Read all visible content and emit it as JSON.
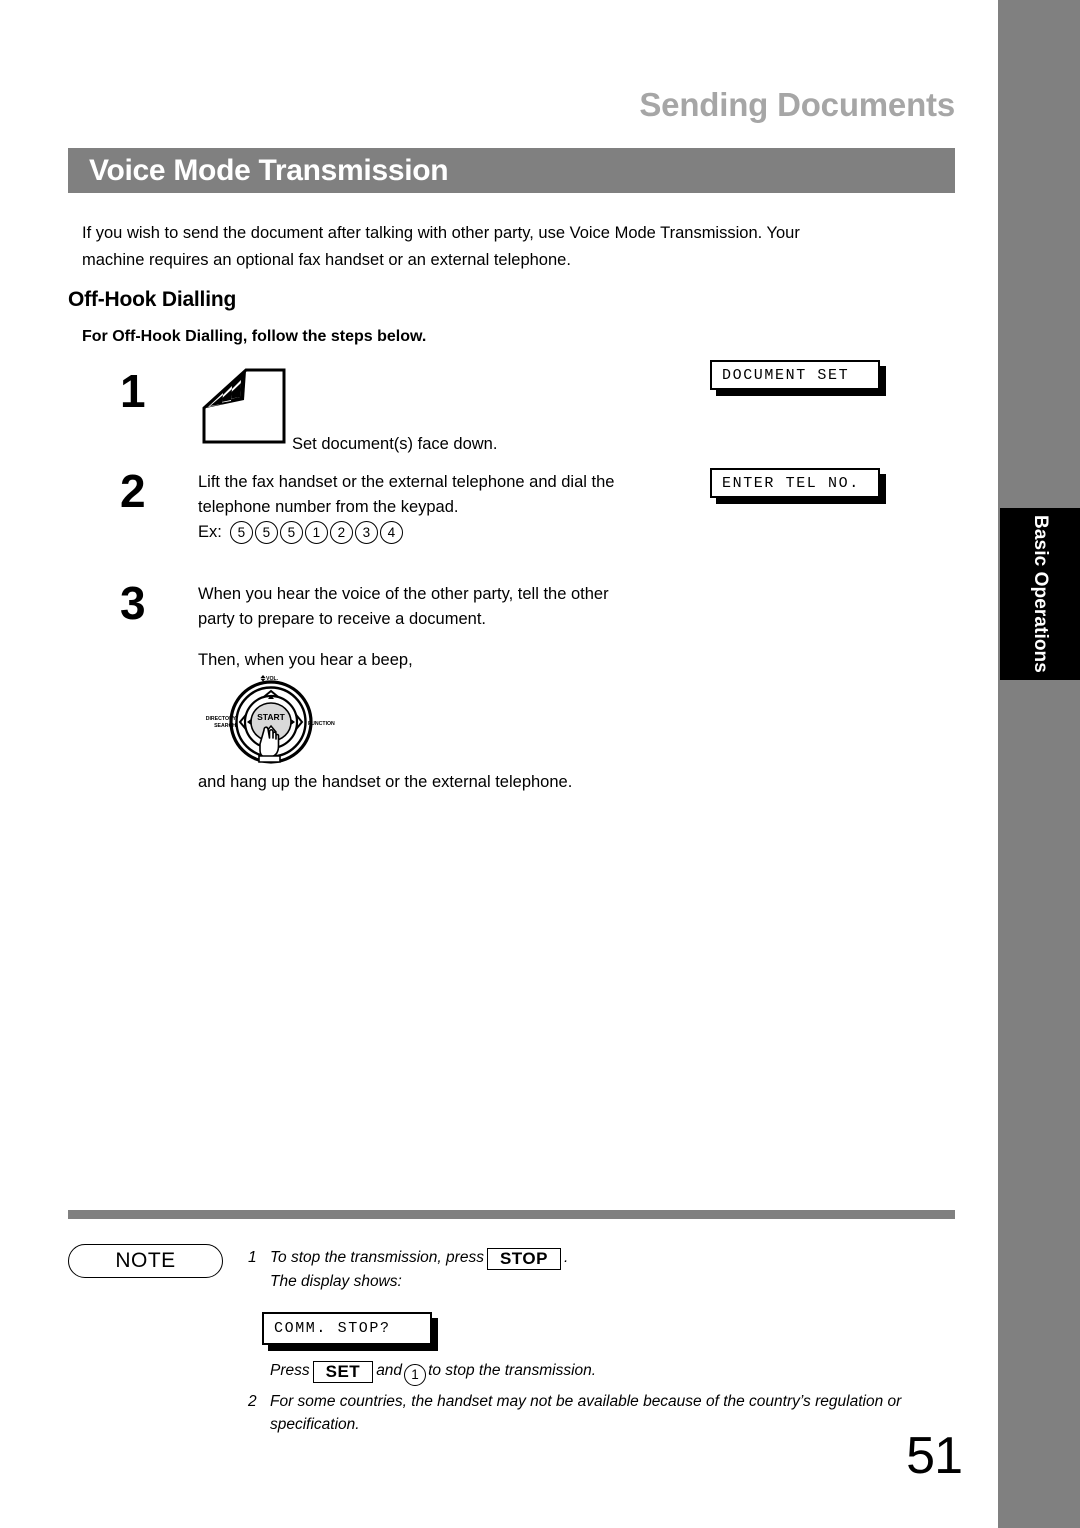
{
  "page": {
    "running_head": "Sending Documents",
    "section_title": "Voice Mode Transmission",
    "number": "51"
  },
  "sidebar": {
    "tab_label": "Basic Operations",
    "bar_color": "#808080",
    "tab_color": "#000000"
  },
  "intro": {
    "line1": "If you wish to send the document after talking with other party, use Voice Mode Transmission. Your",
    "line2": "machine requires an optional fax handset or an external telephone."
  },
  "subsection": {
    "heading": "Off-Hook Dialling",
    "lead": "For Off-Hook Dialling, follow the steps below."
  },
  "steps": [
    {
      "number": "1",
      "caption": "Set document(s) face down.",
      "icon": "document-stack-icon",
      "display": "DOCUMENT SET"
    },
    {
      "number": "2",
      "line1": "Lift the fax handset or the external telephone and dial the",
      "line2": "telephone number from the keypad.",
      "example_label": "Ex:",
      "example_digits": [
        "5",
        "5",
        "5",
        "1",
        "2",
        "3",
        "4"
      ],
      "display": "ENTER TEL NO."
    },
    {
      "number": "3",
      "line1": "When you hear the voice of the other party, tell the other",
      "line2": "party to prepare to receive a document.",
      "beep_text": "Then, when you hear a beep,",
      "hangup_text": "and hang up the handset or the external telephone."
    }
  ],
  "control_panel": {
    "center_button": "START",
    "top_label": "VOL.",
    "left_label_line1": "DIRECTORY",
    "left_label_line2": "SEARCH",
    "right_label": "FUNCTION"
  },
  "note": {
    "badge": "NOTE",
    "item1_marker": "1",
    "item1_part1": "To stop the transmission, press",
    "item1_key": "STOP",
    "item1_part2": ".",
    "item1_line2": "The display shows:",
    "display": "COMM. STOP?",
    "press_part1": "Press",
    "press_key": "SET",
    "press_part2": "and",
    "press_digit": "1",
    "press_part3": "to stop the transmission.",
    "item2_marker": "2",
    "item2_line1": "For some countries, the handset may not be available because of the country’s regulation or",
    "item2_line2": "specification."
  }
}
